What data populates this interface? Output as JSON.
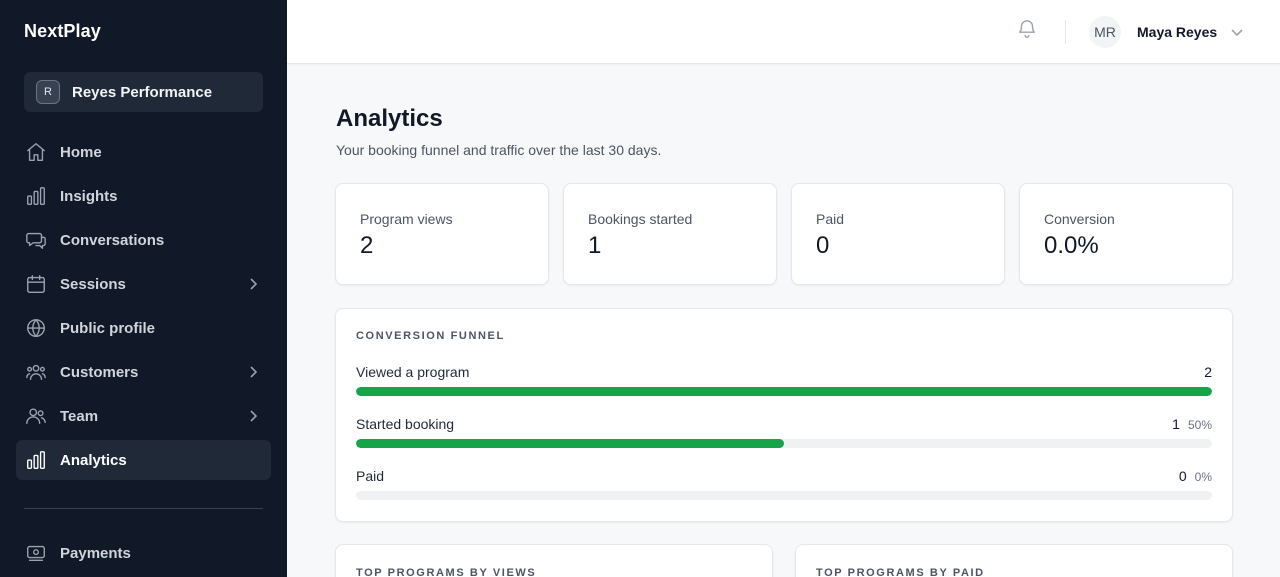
{
  "brand": "NextPlay",
  "org": {
    "initial": "R",
    "name": "Reyes Performance"
  },
  "nav": [
    {
      "label": "Home",
      "icon": "home-icon",
      "chevron": false,
      "active": false
    },
    {
      "label": "Insights",
      "icon": "bar-chart-icon",
      "chevron": false,
      "active": false
    },
    {
      "label": "Conversations",
      "icon": "chat-icon",
      "chevron": false,
      "active": false
    },
    {
      "label": "Sessions",
      "icon": "calendar-icon",
      "chevron": true,
      "active": false
    },
    {
      "label": "Public profile",
      "icon": "globe-icon",
      "chevron": false,
      "active": false
    },
    {
      "label": "Customers",
      "icon": "users-icon",
      "chevron": true,
      "active": false
    },
    {
      "label": "Team",
      "icon": "user-group-icon",
      "chevron": true,
      "active": false
    },
    {
      "label": "Analytics",
      "icon": "analytics-icon",
      "chevron": false,
      "active": true
    }
  ],
  "nav_bottom": [
    {
      "label": "Payments",
      "icon": "payments-icon"
    }
  ],
  "topbar": {
    "user_initials": "MR",
    "user_name": "Maya Reyes",
    "bell_icon": "bell-icon"
  },
  "page": {
    "title": "Analytics",
    "subtitle": "Your booking funnel and traffic over the last 30 days."
  },
  "stats": [
    {
      "label": "Program views",
      "value": "2"
    },
    {
      "label": "Bookings started",
      "value": "1"
    },
    {
      "label": "Paid",
      "value": "0"
    },
    {
      "label": "Conversion",
      "value": "0.0%"
    }
  ],
  "funnel": {
    "title": "Conversion funnel",
    "rows": [
      {
        "label": "Viewed a program",
        "count": "2",
        "pct": "",
        "fill": 1.0
      },
      {
        "label": "Started booking",
        "count": "1",
        "pct": "50%",
        "fill": 0.5
      },
      {
        "label": "Paid",
        "count": "0",
        "pct": "0%",
        "fill": 0.0
      }
    ]
  },
  "panels": {
    "top_views_title": "Top programs by views",
    "top_paid_title": "Top programs by paid"
  },
  "colors": {
    "sidebar_bg": "#111827",
    "accent_green": "#16a34a"
  }
}
